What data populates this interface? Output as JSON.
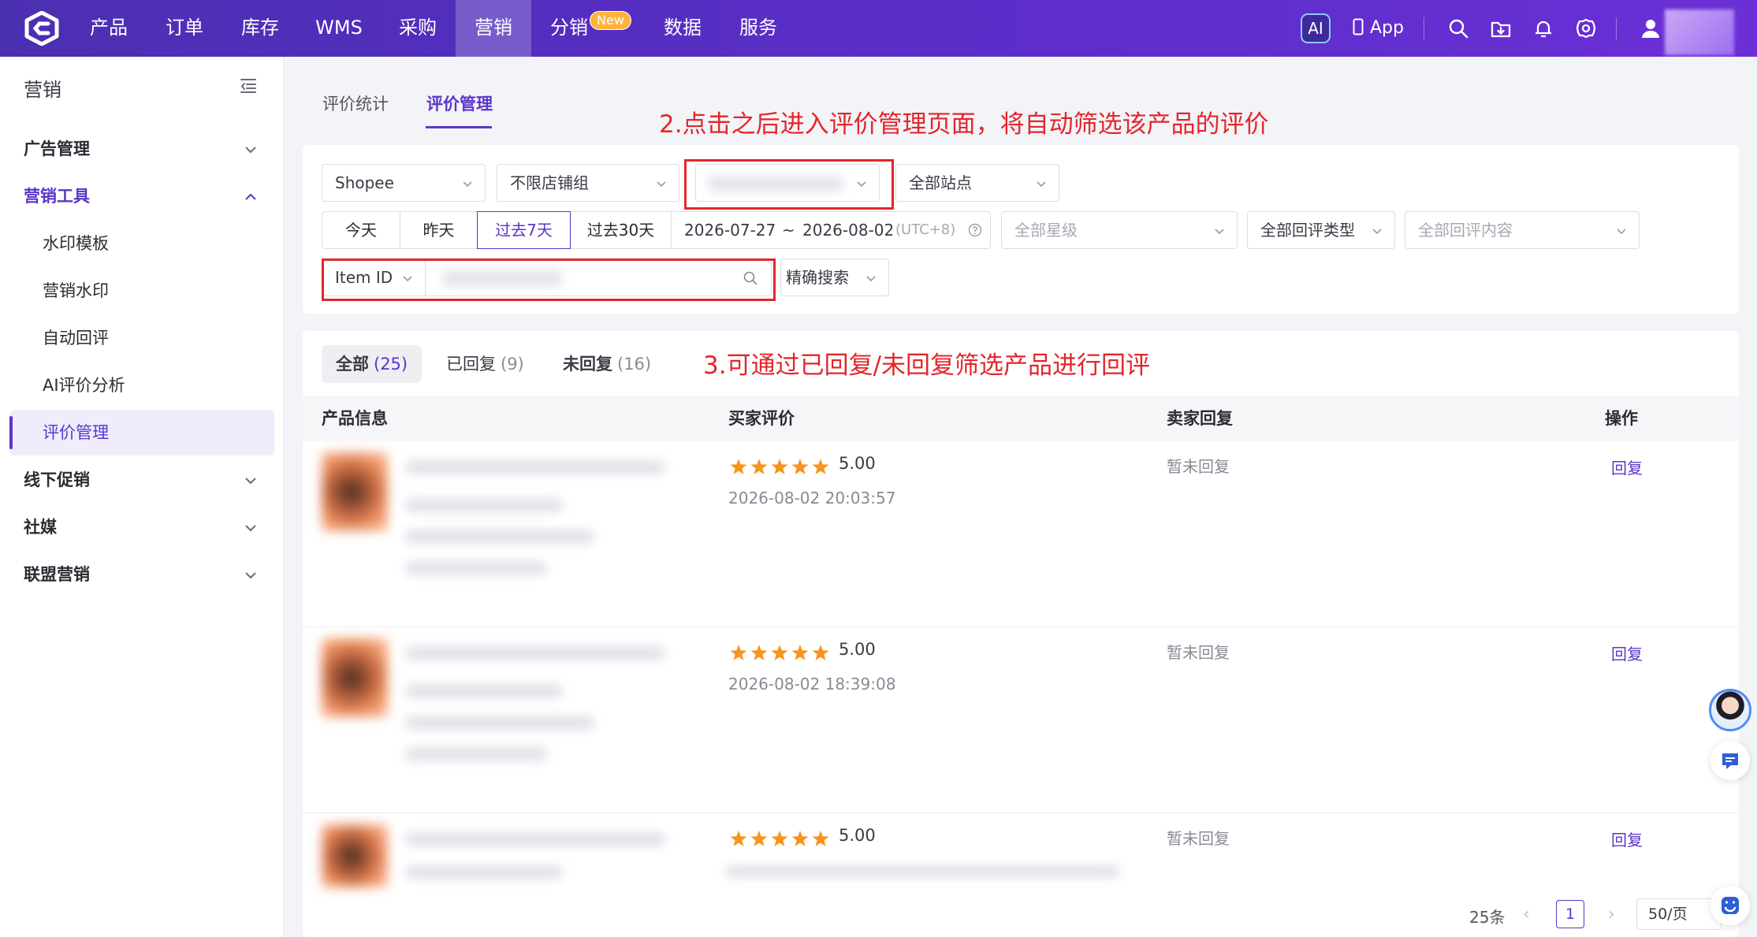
{
  "topbar": {
    "nav": [
      "产品",
      "订单",
      "库存",
      "WMS",
      "采购",
      "营销",
      "分销",
      "数据",
      "服务"
    ],
    "active_nav": "营销",
    "new_badge": "New",
    "ai_label": "AI",
    "app_label": "App",
    "icons": [
      "search-icon",
      "folder-download-icon",
      "bell-icon",
      "settings-icon",
      "user-icon"
    ]
  },
  "sidebar": {
    "title": "营销",
    "groups": [
      {
        "label": "广告管理",
        "expanded": false
      },
      {
        "label": "营销工具",
        "expanded": true,
        "children": [
          "水印模板",
          "营销水印",
          "自动回评",
          "AI评价分析",
          "评价管理"
        ],
        "active_child": "评价管理"
      },
      {
        "label": "线下促销",
        "expanded": false
      },
      {
        "label": "社媒",
        "expanded": false
      },
      {
        "label": "联盟营销",
        "expanded": false
      }
    ]
  },
  "page_tabs": [
    "评价统计",
    "评价管理"
  ],
  "active_page_tab": "评价管理",
  "annotations": {
    "step2": "2.点击之后进入评价管理页面，将自动筛选该产品的评价",
    "step3": "3.可通过已回复/未回复筛选产品进行回评"
  },
  "filters": {
    "platform": "Shopee",
    "shop_group": "不限店铺组",
    "site": "全部站点",
    "date_ranges": [
      "今天",
      "昨天",
      "过去7天",
      "过去30天"
    ],
    "active_date_range": "过去7天",
    "date_start": "2026-07-27",
    "date_sep": "~",
    "date_end": "2026-08-02",
    "timezone": "(UTC+8)",
    "star_placeholder": "全部星级",
    "reply_type": "全部回评类型",
    "reply_content_placeholder": "全部回评内容",
    "search_field": "Item ID",
    "search_mode": "精确搜索"
  },
  "status_tabs": [
    {
      "label": "全部",
      "count": "(25)",
      "active": true
    },
    {
      "label": "已回复",
      "count": "(9)",
      "active": false
    },
    {
      "label": "未回复",
      "count": "(16)",
      "active": false
    }
  ],
  "table": {
    "columns": [
      "产品信息",
      "买家评价",
      "卖家回复",
      "操作"
    ],
    "rows": [
      {
        "rating": 5,
        "score": "5.00",
        "time": "2026-08-02 20:03:57",
        "reply": "暂未回复",
        "action": "回复"
      },
      {
        "rating": 5,
        "score": "5.00",
        "time": "2026-08-02 18:39:08",
        "reply": "暂未回复",
        "action": "回复"
      },
      {
        "rating": 5,
        "score": "5.00",
        "time": "",
        "reply": "暂未回复",
        "action": "回复"
      }
    ]
  },
  "pagination": {
    "total": "25条",
    "current_page": "1",
    "page_size": "50/页"
  },
  "colors": {
    "brand": "#5b35c9",
    "annotation": "#e3262c",
    "star": "#f7941d"
  }
}
